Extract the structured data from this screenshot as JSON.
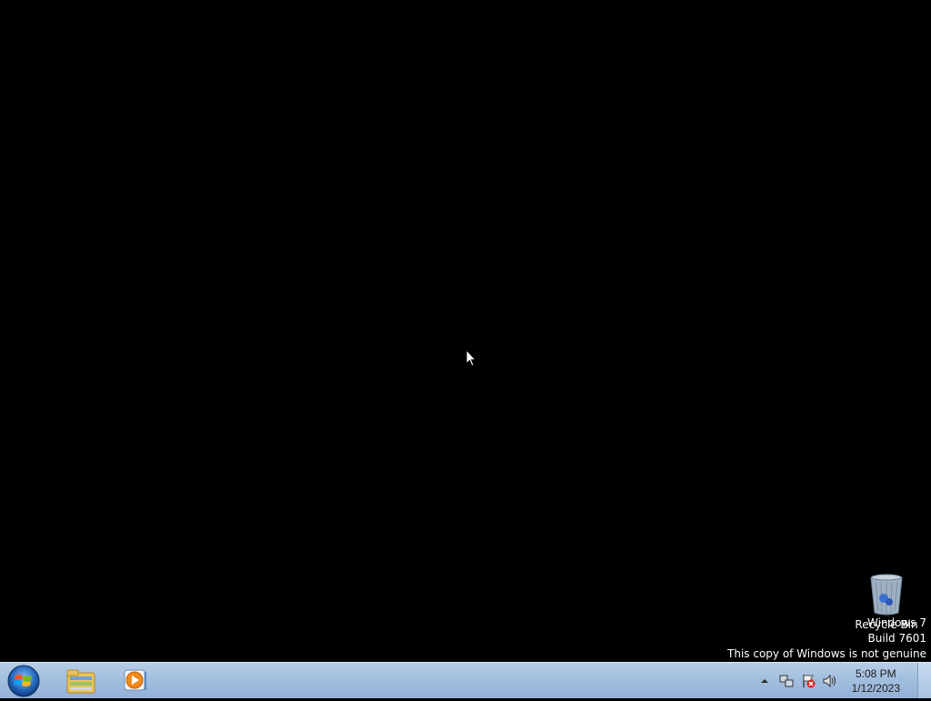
{
  "desktop": {
    "icons": [
      {
        "label": "Recycle Bin",
        "icon": "recycle-bin-icon"
      }
    ],
    "watermark": {
      "line1": "Windows 7",
      "line2": "Build 7601",
      "line3": "This copy of Windows is not genuine"
    }
  },
  "taskbar": {
    "start": {
      "icon": "windows-start-orb-icon"
    },
    "pinned": [
      {
        "name": "Windows Explorer",
        "icon": "folder-library-icon"
      },
      {
        "name": "Windows Media Player",
        "icon": "media-player-icon"
      }
    ],
    "tray": {
      "icons": [
        "show-hidden-icons-arrow",
        "network-icon",
        "action-center-flag-icon",
        "volume-icon"
      ],
      "time": "5:08 PM",
      "date": "1/12/2023"
    }
  },
  "colors": {
    "desktop_bg": "#000000",
    "taskbar": "#a3bfdf"
  }
}
